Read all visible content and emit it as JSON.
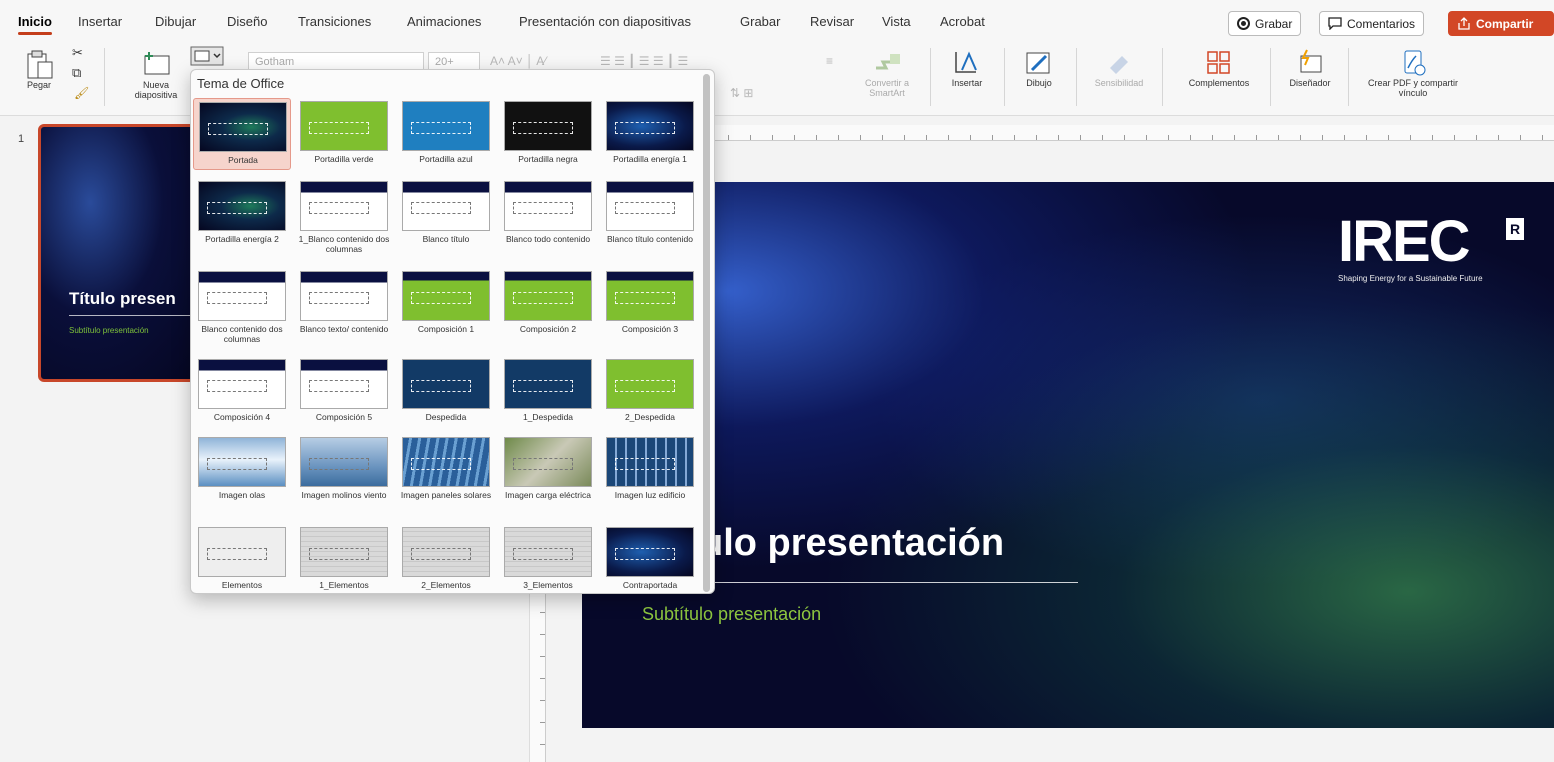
{
  "tabs": [
    "Inicio",
    "Insertar",
    "Dibujar",
    "Diseño",
    "Transiciones",
    "Animaciones",
    "Presentación con diapositivas",
    "Grabar",
    "Revisar",
    "Vista",
    "Acrobat"
  ],
  "active_tab": "Inicio",
  "top_actions": {
    "record": "Grabar",
    "comments": "Comentarios",
    "share": "Compartir"
  },
  "ribbon": {
    "paste": "Pegar",
    "new_slide": "Nueva diapositiva",
    "font_name": "Gotham",
    "font_size": "20+",
    "convert_smartart": "Convertir a SmartArt",
    "insert": "Insertar",
    "draw": "Dibujo",
    "sensitivity": "Sensibilidad",
    "addins": "Complementos",
    "designer": "Diseñador",
    "create_pdf": "Crear PDF y compartir vínculo"
  },
  "dropdown": {
    "header": "Tema de Office",
    "layouts": [
      {
        "name": "Portada",
        "bg": "dark",
        "selected": true
      },
      {
        "name": "Portadilla verde",
        "bg": "green"
      },
      {
        "name": "Portadilla azul",
        "bg": "blue"
      },
      {
        "name": "Portadilla negra",
        "bg": "black"
      },
      {
        "name": "Portadilla energía 1",
        "bg": "energy"
      },
      {
        "name": "Portadilla energía 2",
        "bg": "dark"
      },
      {
        "name": "1_Blanco contenido dos columnas",
        "bg": "white-top"
      },
      {
        "name": "Blanco título",
        "bg": "white-top"
      },
      {
        "name": "Blanco todo contenido",
        "bg": "white-top"
      },
      {
        "name": "Blanco título contenido",
        "bg": "white-top"
      },
      {
        "name": "Blanco contenido dos columnas",
        "bg": "white-top"
      },
      {
        "name": "Blanco texto/ contenido",
        "bg": "white-top"
      },
      {
        "name": "Composición 1",
        "bg": "green-top"
      },
      {
        "name": "Composición 2",
        "bg": "green-top"
      },
      {
        "name": "Composición 3",
        "bg": "green-top"
      },
      {
        "name": "Composición 4",
        "bg": "white-top"
      },
      {
        "name": "Composición 5",
        "bg": "white-top"
      },
      {
        "name": "Despedida",
        "bg": "navy"
      },
      {
        "name": "1_Despedida",
        "bg": "navy"
      },
      {
        "name": "2_Despedida",
        "bg": "green"
      },
      {
        "name": "Imagen olas",
        "bg": "waves"
      },
      {
        "name": "Imagen molinos viento",
        "bg": "wind"
      },
      {
        "name": "Imagen paneles solares",
        "bg": "solar"
      },
      {
        "name": "Imagen carga eléctrica",
        "bg": "charge"
      },
      {
        "name": "Imagen luz edificio",
        "bg": "building"
      },
      {
        "name": "Elementos",
        "bg": "elem"
      },
      {
        "name": "1_Elementos",
        "bg": "grey"
      },
      {
        "name": "2_Elementos",
        "bg": "grey"
      },
      {
        "name": "3_Elementos",
        "bg": "grey"
      },
      {
        "name": "Contraportada",
        "bg": "energy"
      }
    ]
  },
  "thumbnail": {
    "number": "1",
    "title": "Título presen",
    "subtitle": "Subtítulo presentación"
  },
  "slide": {
    "title": "ulo presentación",
    "subtitle": "Subtítulo presentación",
    "logo": "IREC",
    "logo_mark": "R",
    "logo_tagline": "Shaping Energy for a Sustainable Future"
  },
  "colors": {
    "accent": "#c43e1c",
    "share": "#d24726",
    "green": "#8dc63f",
    "slide_bg": "#07092a"
  }
}
